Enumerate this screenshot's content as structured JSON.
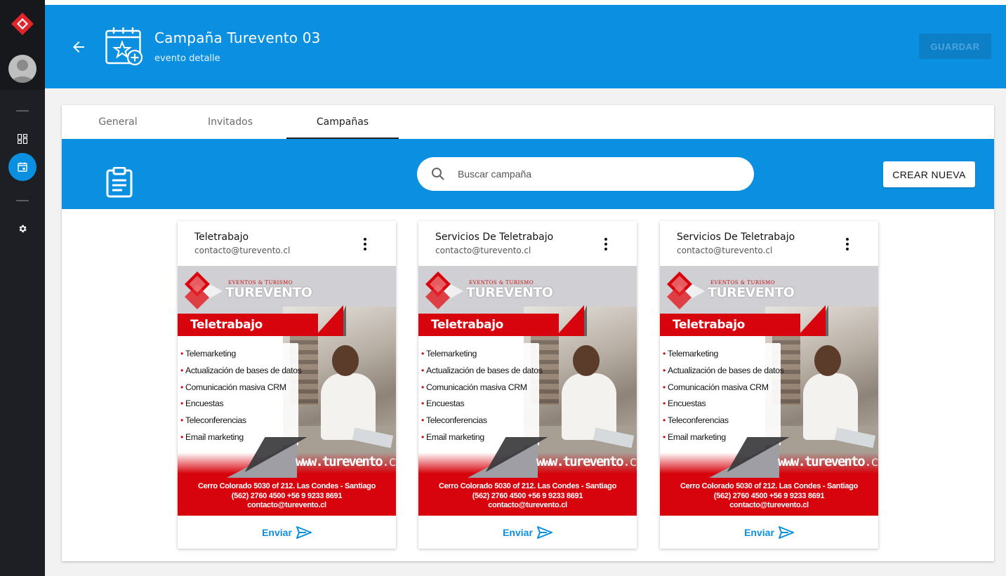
{
  "header": {
    "title": "Campaña Turevento 03",
    "subtitle": "evento detalle",
    "save_label": "GUARDAR"
  },
  "sidebar": {
    "items": [
      {
        "icon": "dashboard-icon",
        "active": false
      },
      {
        "icon": "calendar-icon",
        "active": true
      },
      {
        "icon": "gear-icon",
        "active": false
      }
    ]
  },
  "tabs": [
    {
      "label": "General",
      "active": false
    },
    {
      "label": "Invitados",
      "active": false
    },
    {
      "label": "Campañas",
      "active": true
    }
  ],
  "toolbar": {
    "search_placeholder": "Buscar campaña",
    "create_label": "CREAR NUEVA"
  },
  "flyer": {
    "brand_small": "EVENTOS & TURISMO",
    "brand": "TUREVENTO",
    "banner": "Teletrabajo",
    "services": [
      "Telemarketing",
      "Actualización de bases de datos",
      "Comunicación masiva CRM",
      "Encuestas",
      "Teleconferencias",
      "Email marketing"
    ],
    "url_prefix": "www.",
    "url_name": "turevento",
    "url_domain": ".cl",
    "address": "Cerro Colorado 5030 of 212. Las Condes - Santiago",
    "phones": "(562) 2760 4500     +56 9 9233 8691",
    "email": "contacto@turevento.cl"
  },
  "cards": [
    {
      "title": "Teletrabajo",
      "email": "contacto@turevento.cl",
      "send_label": "Enviar"
    },
    {
      "title": "Servicios De Teletrabajo",
      "email": "contacto@turevento.cl",
      "send_label": "Enviar"
    },
    {
      "title": "Servicios De Teletrabajo",
      "email": "contacto@turevento.cl",
      "send_label": "Enviar"
    }
  ],
  "colors": {
    "primary": "#0b8fe0",
    "sidebar": "#1e1f24",
    "flyer_red": "#d7040d"
  }
}
